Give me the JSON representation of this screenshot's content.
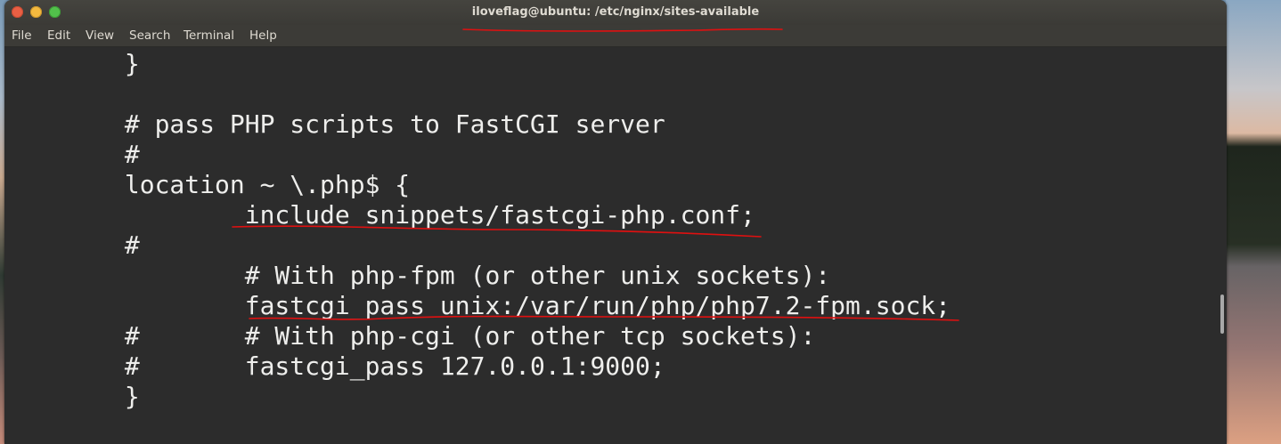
{
  "window": {
    "title": "iloveflag@ubuntu: /etc/nginx/sites-available"
  },
  "menu": [
    "File",
    "Edit",
    "View",
    "Search",
    "Terminal",
    "Help"
  ],
  "terminal": {
    "lines": [
      "        }",
      "",
      "        # pass PHP scripts to FastCGI server",
      "        #",
      "        location ~ \\.php$ {",
      "                include snippets/fastcgi-php.conf;",
      "        #",
      "                # With php-fpm (or other unix sockets):",
      "                fastcgi_pass unix:/var/run/php/php7.2-fpm.sock;",
      "        #       # With php-cgi (or other tcp sockets):",
      "        #       fastcgi_pass 127.0.0.1:9000;",
      "        }"
    ]
  },
  "colors": {
    "annotation": "#e01010",
    "terminal_bg": "#2c2c2c",
    "terminal_fg": "#eeeeec"
  }
}
